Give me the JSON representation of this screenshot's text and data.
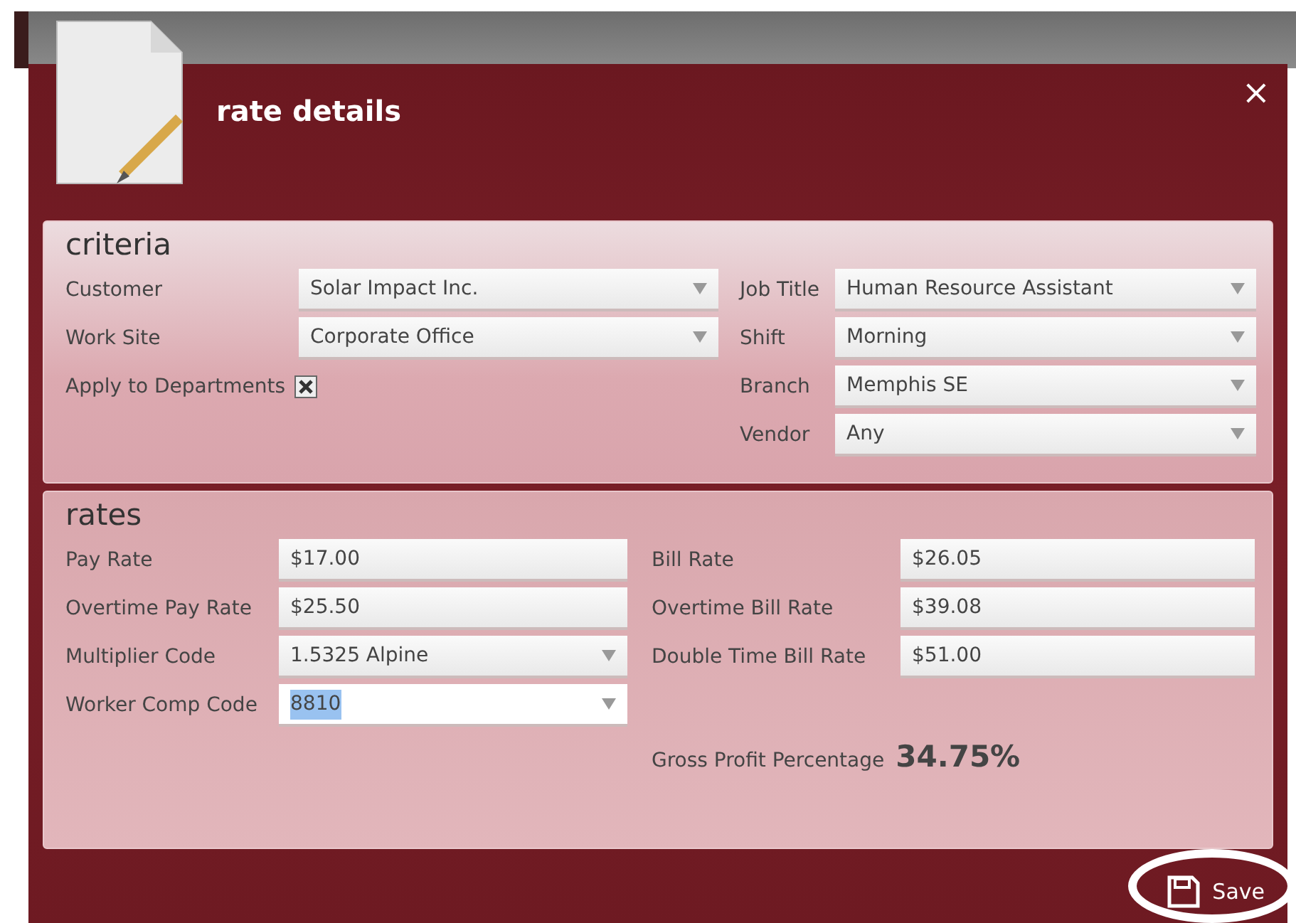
{
  "dialog": {
    "title": "rate details",
    "close": "×"
  },
  "criteria": {
    "heading": "criteria",
    "left": [
      {
        "kind": "dropdown",
        "label": "Customer",
        "value": "Solar Impact Inc.",
        "focused": false
      },
      {
        "kind": "dropdown",
        "label": "Work Site",
        "value": "Corporate Office",
        "focused": false
      },
      {
        "kind": "checkbox",
        "label": "Apply to Departments",
        "checked": true
      }
    ],
    "right": [
      {
        "kind": "dropdown",
        "label": "Job Title",
        "value": "Human Resource Assistant",
        "focused": false
      },
      {
        "kind": "dropdown",
        "label": "Shift",
        "value": "Morning",
        "focused": false
      },
      {
        "kind": "dropdown",
        "label": "Branch",
        "value": "Memphis SE",
        "focused": false
      },
      {
        "kind": "dropdown",
        "label": "Vendor",
        "value": "Any",
        "focused": false
      }
    ]
  },
  "rates": {
    "heading": "rates",
    "left": [
      {
        "kind": "text",
        "label": "Pay Rate",
        "value": "$17.00",
        "focused": false
      },
      {
        "kind": "text",
        "label": "Overtime Pay Rate",
        "value": "$25.50",
        "focused": false
      },
      {
        "kind": "dropdown",
        "label": "Multiplier Code",
        "value": "1.5325 Alpine",
        "focused": false
      },
      {
        "kind": "dropdown",
        "label": "Worker Comp Code",
        "value": "8810",
        "focused": true
      }
    ],
    "right": [
      {
        "kind": "text",
        "label": "Bill Rate",
        "value": "$26.05",
        "focused": false
      },
      {
        "kind": "text",
        "label": "Overtime Bill Rate",
        "value": "$39.08",
        "focused": false
      },
      {
        "kind": "text",
        "label": "Double Time Bill Rate",
        "value": "$51.00",
        "focused": false
      }
    ],
    "gross_profit": {
      "label": "Gross Profit Percentage",
      "value": "34.75%"
    }
  },
  "save_button": {
    "label": "Save",
    "circled": true
  }
}
